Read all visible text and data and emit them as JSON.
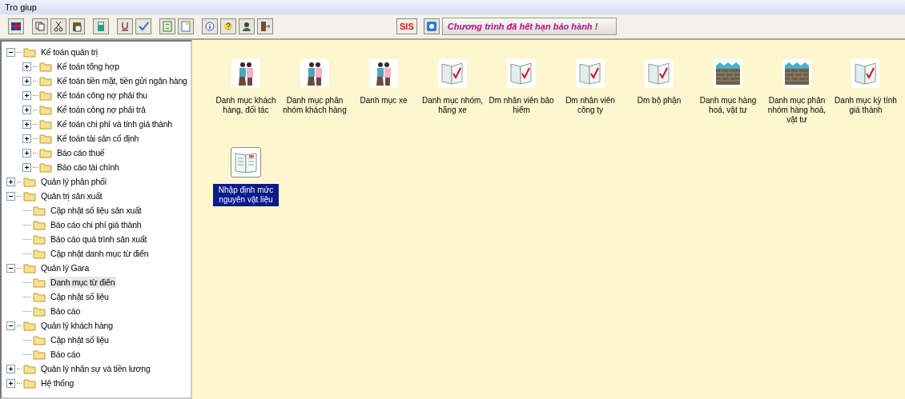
{
  "menu": [
    {
      "label": "Tro giup"
    }
  ],
  "toolbar": {
    "app_button": "SIS",
    "notice": "Chương trình đã hết hạn bảo hành !"
  },
  "tree": [
    {
      "label": "Kế toán quản trị",
      "expanded": true,
      "selected": false,
      "children": [
        {
          "label": "Kế toán tổng hợp",
          "expanded": false,
          "selected": false
        },
        {
          "label": "Kế toán tiền mặt, tiền gửi ngân hàng",
          "expanded": false,
          "selected": false
        },
        {
          "label": "Kế toán công nợ phải thu",
          "expanded": false,
          "selected": false
        },
        {
          "label": "Kế toán công nợ phải trả",
          "expanded": false,
          "selected": false
        },
        {
          "label": "Kế toán chi phí và tính giá thành",
          "expanded": false,
          "selected": false
        },
        {
          "label": "Kế toán tài sản cố định",
          "expanded": false,
          "selected": false
        },
        {
          "label": "Báo cáo thuế",
          "expanded": false,
          "selected": false
        },
        {
          "label": "Báo cáo tài chính",
          "expanded": false,
          "selected": false
        }
      ]
    },
    {
      "label": "Quản lý phân phối",
      "expanded": false,
      "selected": false
    },
    {
      "label": "Quản trị sản xuất",
      "expanded": true,
      "selected": false,
      "children": [
        {
          "label": "Cập nhật số liệu sản xuất",
          "selected": false
        },
        {
          "label": "Báo cáo chi phí giá thành",
          "selected": false
        },
        {
          "label": "Báo cáo quá trình sản xuất",
          "selected": false
        },
        {
          "label": "Cập nhật danh mục từ điển",
          "selected": false
        }
      ]
    },
    {
      "label": "Quản lý Gara",
      "expanded": true,
      "selected": false,
      "children": [
        {
          "label": "Danh mục từ điển",
          "selected": true
        },
        {
          "label": "Cập nhật số liệu",
          "selected": false
        },
        {
          "label": "Báo cáo",
          "selected": false
        }
      ]
    },
    {
      "label": "Quản lý khách hàng",
      "expanded": true,
      "selected": false,
      "children": [
        {
          "label": "Cập nhật số liệu",
          "selected": false
        },
        {
          "label": "Báo cáo",
          "selected": false
        }
      ]
    },
    {
      "label": "Quản lý nhân sự và tiền lương",
      "expanded": false,
      "selected": false
    },
    {
      "label": "Hệ thống",
      "expanded": false,
      "selected": false
    }
  ],
  "items": [
    {
      "kind": "people",
      "label": "Danh mục khách hàng, đối tác",
      "selected": false
    },
    {
      "kind": "people",
      "label": "Danh mục phân nhóm khách hàng",
      "selected": false
    },
    {
      "kind": "people",
      "label": "Danh mục xe",
      "selected": false
    },
    {
      "kind": "book",
      "label": "Danh mục nhóm, hãng xe",
      "selected": false
    },
    {
      "kind": "book",
      "label": "Dm nhân viên bảo hiểm",
      "selected": false
    },
    {
      "kind": "book",
      "label": "Dm nhân viên công ty",
      "selected": false
    },
    {
      "kind": "book",
      "label": "Dm bộ phận",
      "selected": false
    },
    {
      "kind": "bricks",
      "label": "Danh mục hàng hoá, vật tư",
      "selected": false
    },
    {
      "kind": "bricks",
      "label": "Danh mục phân nhóm hàng hoá, vật tư",
      "selected": false
    },
    {
      "kind": "book",
      "label": "Danh mục kỳ tính giá thành",
      "selected": false
    },
    {
      "kind": "sheet",
      "label": "Nhập định mức nguyên vật liệu",
      "selected": true
    }
  ]
}
